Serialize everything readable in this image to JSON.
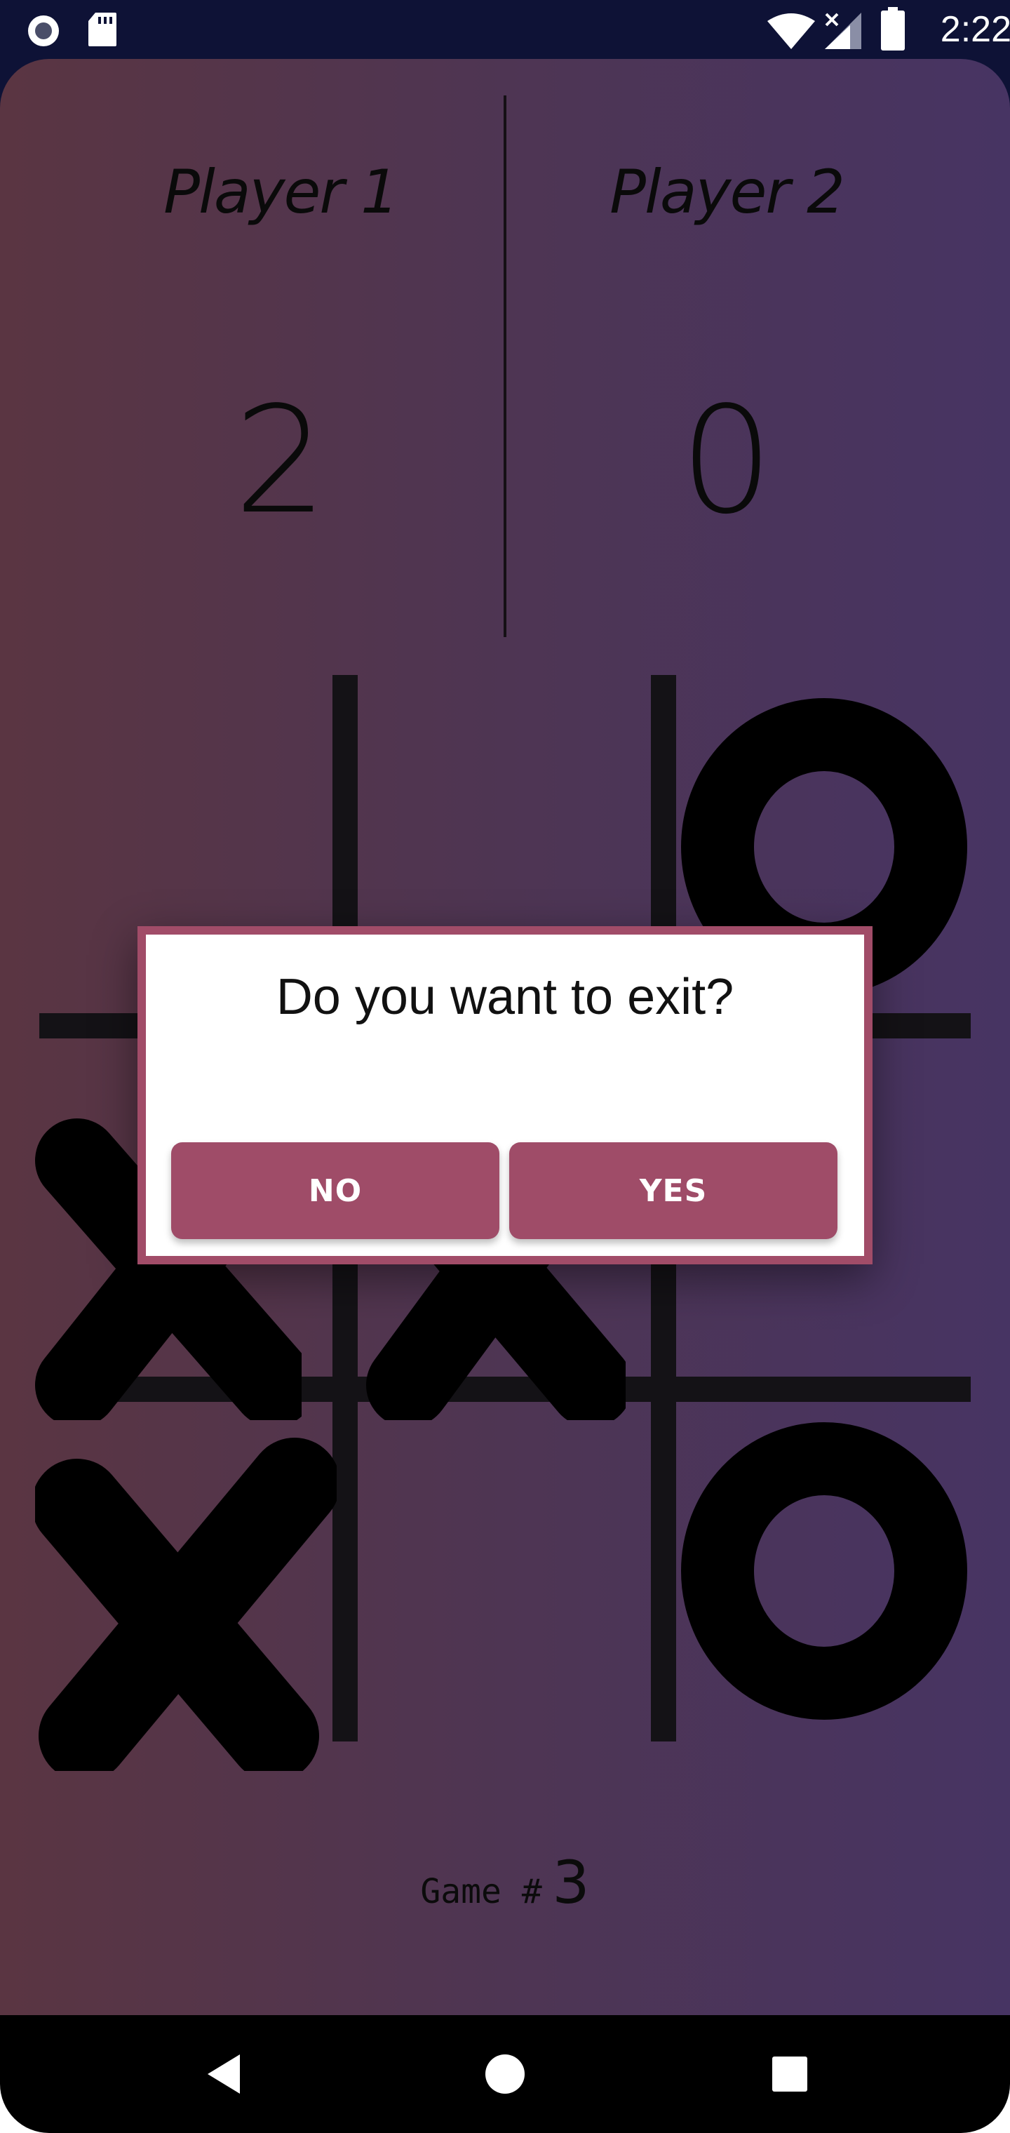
{
  "status_bar": {
    "time": "2:22",
    "icons": [
      "record-icon",
      "sd-card-icon",
      "wifi-icon",
      "signal-icon",
      "battery-icon"
    ]
  },
  "scoreboard": {
    "player1": {
      "label": "Player 1",
      "score": "2"
    },
    "player2": {
      "label": "Player 2",
      "score": "0"
    }
  },
  "board": {
    "cells": [
      "",
      "",
      "O",
      "X",
      "X",
      "",
      "X",
      "",
      "O"
    ]
  },
  "game_counter": {
    "label": "Game #",
    "number": "3"
  },
  "dialog": {
    "message": "Do you want to exit?",
    "no_label": "NO",
    "yes_label": "YES"
  },
  "nav_bar": {
    "icons": [
      "back-icon",
      "home-icon",
      "recents-icon"
    ]
  },
  "colors": {
    "gradient_left": "#5a3542",
    "gradient_right": "#473463",
    "accent": "#a14c68",
    "status_bar": "#0e1236"
  }
}
